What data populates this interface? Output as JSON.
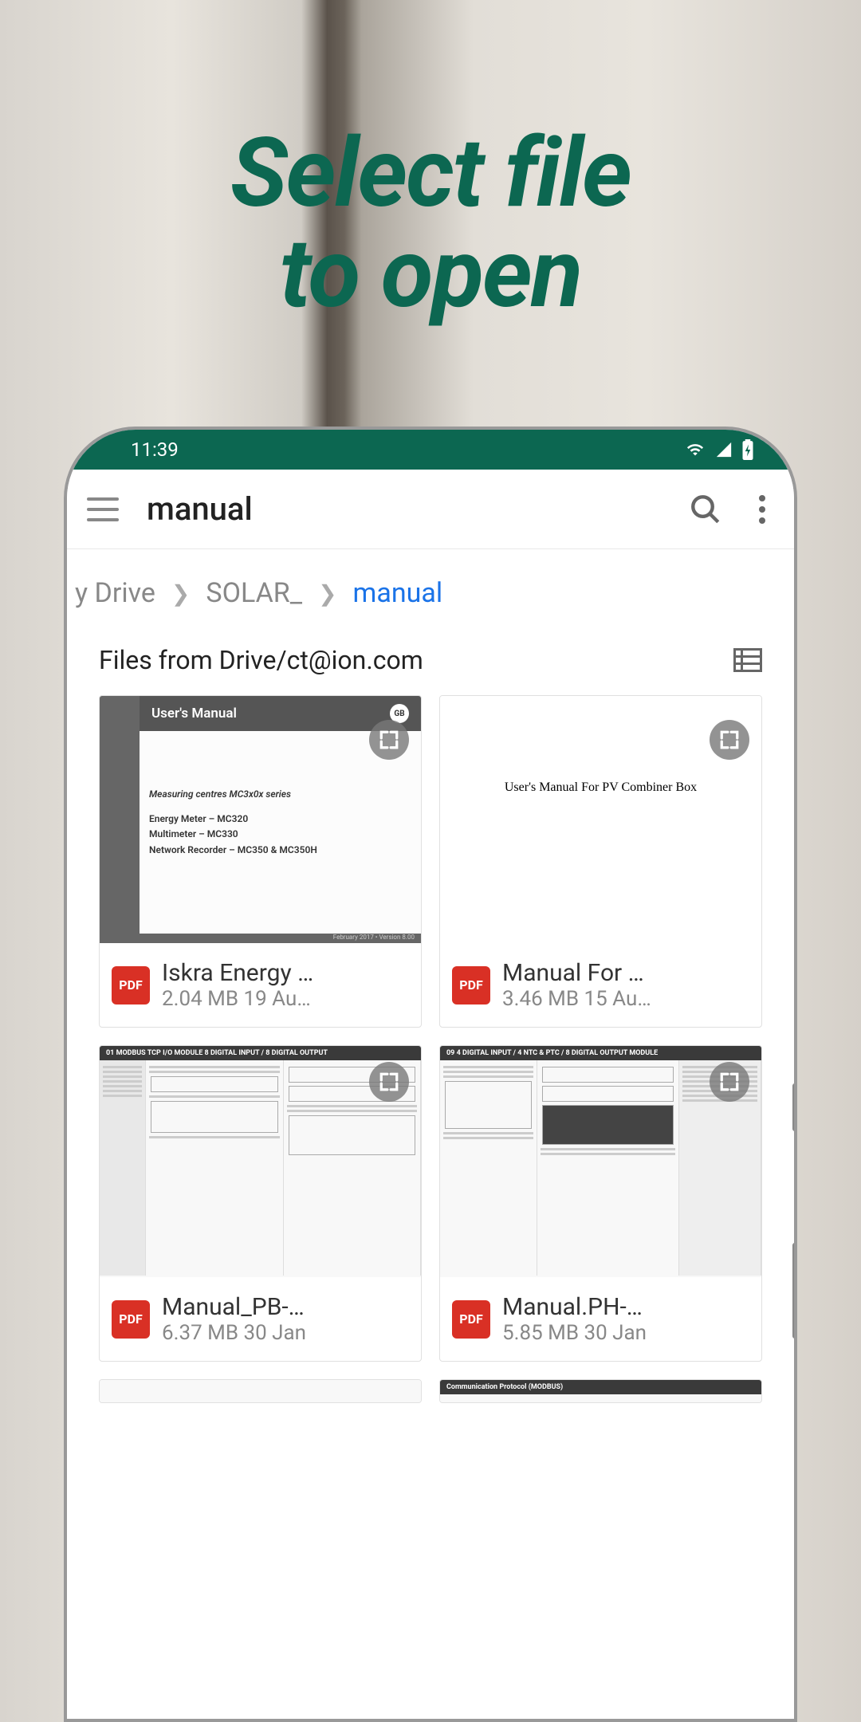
{
  "marketing": {
    "headline_line1": "Select file",
    "headline_line2": "to open"
  },
  "status_bar": {
    "time": "11:39"
  },
  "app_bar": {
    "title": "manual"
  },
  "breadcrumb": {
    "item1": "y Drive",
    "item2": "SOLAR_",
    "item3": "manual"
  },
  "section": {
    "title": "Files from Drive/ct@ion.com"
  },
  "files": [
    {
      "title": "Iskra Energy …",
      "meta": "2.04 MB 19 Au…",
      "badge": "PDF",
      "thumb": {
        "heading": "User's Manual",
        "sub1": "Measuring centres MC3x0x series",
        "sub2": "Energy Meter – MC320",
        "sub3": "Multimeter – MC330",
        "sub4": "Network Recorder – MC350 & MC350H",
        "foot": "February 2017 • Version 8.00"
      }
    },
    {
      "title": "Manual For …",
      "meta": "3.46 MB 15 Au…",
      "badge": "PDF",
      "thumb": {
        "text": "User's Manual For PV Combiner Box"
      }
    },
    {
      "title": "Manual_PB-…",
      "meta": "6.37 MB 30 Jan",
      "badge": "PDF",
      "thumb": {
        "header": "01   MODBUS TCP I/O MODULE  8 DIGITAL INPUT / 8 DIGITAL OUTPUT"
      }
    },
    {
      "title": "Manual.PH-…",
      "meta": "5.85 MB 30 Jan",
      "badge": "PDF",
      "thumb": {
        "header": "09   4 DIGITAL INPUT / 4 NTC & PTC / 8 DIGITAL OUTPUT MODULE"
      }
    }
  ]
}
